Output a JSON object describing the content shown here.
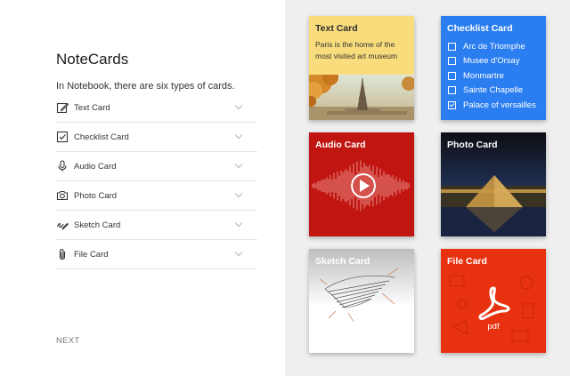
{
  "app": {
    "title": "NoteCards",
    "subtitle": "In Notebook, there are six types of cards."
  },
  "card_types": [
    {
      "label": "Text Card",
      "icon": "edit-icon"
    },
    {
      "label": "Checklist Card",
      "icon": "checkbox-icon"
    },
    {
      "label": "Audio Card",
      "icon": "microphone-icon"
    },
    {
      "label": "Photo Card",
      "icon": "camera-icon"
    },
    {
      "label": "Sketch Card",
      "icon": "sketch-icon"
    },
    {
      "label": "File Card",
      "icon": "paperclip-icon"
    }
  ],
  "next_label": "NEXT",
  "cards": {
    "text": {
      "title": "Text Card",
      "body": "Paris is the home of the most visited art museum",
      "color": "#f9dc7c"
    },
    "checklist": {
      "title": "Checklist Card",
      "color": "#2b7ef0",
      "items": [
        {
          "label": "Arc de Triomphe",
          "checked": false
        },
        {
          "label": "Musee d'Orsay",
          "checked": false
        },
        {
          "label": "Monmartre",
          "checked": false
        },
        {
          "label": "Sainte Chapelle",
          "checked": false
        },
        {
          "label": "Palace of versailles",
          "checked": true
        }
      ]
    },
    "audio": {
      "title": "Audio Card",
      "color": "#c01511"
    },
    "photo": {
      "title": "Photo Card"
    },
    "sketch": {
      "title": "Sketch Card"
    },
    "file": {
      "title": "File Card",
      "file_type": "pdf",
      "color": "#e8310f"
    }
  }
}
